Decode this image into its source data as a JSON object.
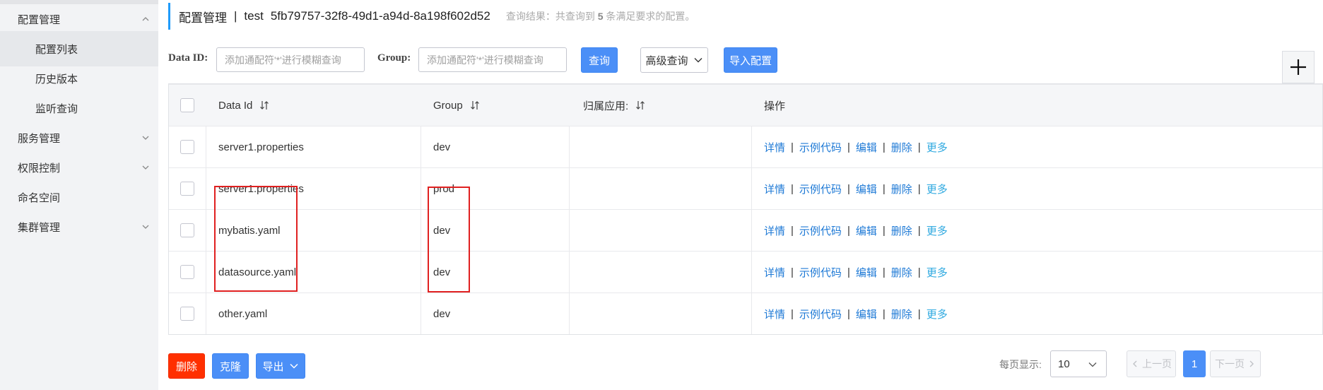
{
  "sidebar": {
    "items": [
      {
        "label": "配置管理"
      },
      {
        "label": "配置列表"
      },
      {
        "label": "历史版本"
      },
      {
        "label": "监听查询"
      },
      {
        "label": "服务管理"
      },
      {
        "label": "权限控制"
      },
      {
        "label": "命名空间"
      },
      {
        "label": "集群管理"
      }
    ]
  },
  "header": {
    "title": "配置管理",
    "separator": "|",
    "namespace": "test",
    "namespace_id": "5fb79757-32f8-49d1-a94d-8a198f602d52",
    "result_prefix": "查询结果：共查询到",
    "result_count": "5",
    "result_suffix": "条满足要求的配置。"
  },
  "filters": {
    "data_id_label": "Data ID:",
    "data_id_placeholder": "添加通配符'*'进行模糊查询",
    "group_label": "Group:",
    "group_placeholder": "添加通配符'*'进行模糊查询",
    "query_label": "查询",
    "advanced_label": "高级查询",
    "import_label": "导入配置"
  },
  "table": {
    "headers": {
      "data_id": "Data Id",
      "group": "Group",
      "app": "归属应用:",
      "ops": "操作"
    },
    "rows": [
      {
        "data_id": "server1.properties",
        "group": "dev",
        "app": ""
      },
      {
        "data_id": "server1.properties",
        "group": "prod",
        "app": ""
      },
      {
        "data_id": "mybatis.yaml",
        "group": "dev",
        "app": ""
      },
      {
        "data_id": "datasource.yaml",
        "group": "dev",
        "app": ""
      },
      {
        "data_id": "other.yaml",
        "group": "dev",
        "app": ""
      }
    ],
    "ops": {
      "detail": "详情",
      "sample": "示例代码",
      "edit": "编辑",
      "delete": "删除",
      "more": "更多",
      "sep": "|"
    }
  },
  "footer": {
    "delete_label": "删除",
    "clone_label": "克隆",
    "export_label": "导出",
    "page_size_label": "每页显示:",
    "page_size": "10",
    "prev_label": "上一页",
    "next_label": "下一页",
    "current_page": "1"
  },
  "colors": {
    "accent": "#4b8ff7",
    "danger": "#ff3000",
    "link": "#1f7ad6",
    "more_link": "#2fa9e0",
    "highlight": "#e02020"
  }
}
